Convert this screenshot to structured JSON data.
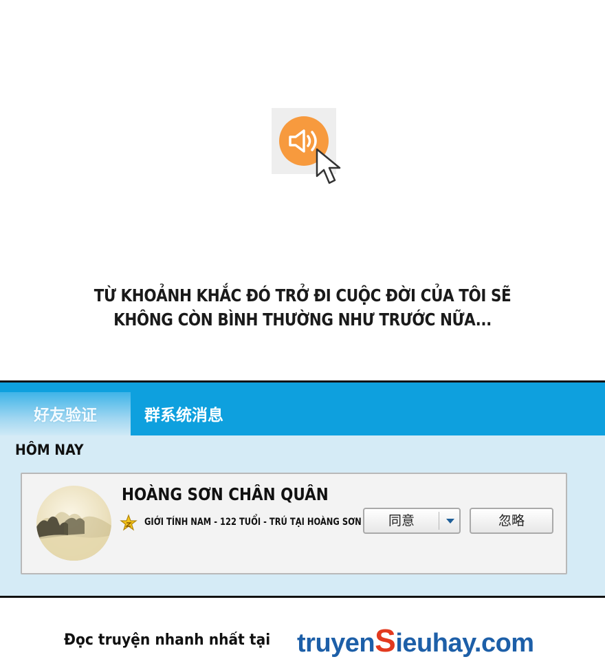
{
  "caption": {
    "line1": "TỪ KHOẢNH KHẮC ĐÓ TRỞ ĐI CUỘC ĐỜI CỦA TÔI SẼ",
    "line2": "KHÔNG CÒN BÌNH THƯỜNG NHƯ TRƯỚC NỮA..."
  },
  "icons": {
    "speaker": "speaker-icon",
    "cursor": "cursor-icon",
    "star": "star-icon",
    "dropdown": "chevron-down-icon"
  },
  "colors": {
    "tab_bar": "#0ea0de",
    "panel_bg": "#d5ebf6",
    "speaker_orange": "#f79a3e",
    "site_blue": "#1d5fa8",
    "site_red": "#e23a1f"
  },
  "tabs": [
    {
      "label": "好友验证",
      "active": true
    },
    {
      "label": "群系统消息",
      "active": false
    }
  ],
  "section_label": "HÔM NAY",
  "request": {
    "name": "HOÀNG SƠN CHÂN QUÂN",
    "info": "GIỚI TÍNH NAM - 122 TUỔI - TRÚ TẠI HOÀNG SƠN",
    "agree_label": "同意",
    "ignore_label": "忽略"
  },
  "footer": {
    "text": "Đọc truyện nhanh nhất tại",
    "site_prefix": "truyen",
    "site_s": "S",
    "site_suffix": "ieuhay.com"
  }
}
